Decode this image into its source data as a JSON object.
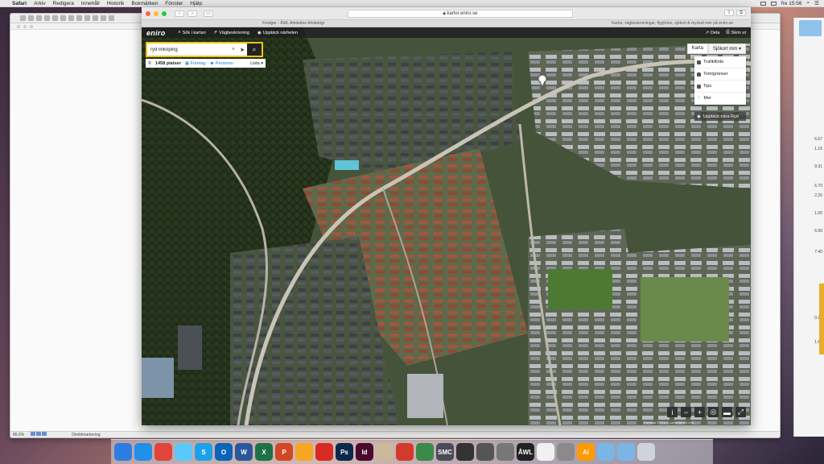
{
  "menubar": {
    "apple": "",
    "items": [
      "Safari",
      "Arkiv",
      "Redigera",
      "Innehåll",
      "Historik",
      "Bokmärken",
      "Fönster",
      "Hjälp"
    ],
    "clock": "fre 15:56"
  },
  "doc_window": {
    "status_zoom": "86.6%",
    "status_mode": "Direktmarkering"
  },
  "right_window": {
    "numbers": [
      "6.67",
      "1.16",
      "9.31",
      "6.70",
      "2.20",
      "1.00",
      "5.50",
      "7.40",
      "0.18",
      "1.60"
    ]
  },
  "safari": {
    "url": "kartor.eniro.se",
    "tab_left": "Kredger - ÅWL Arkitekter Arkitektgr",
    "tab_right": "Kartor, vägbeskrivningar, flygfoton, sjökort & mycket mer på eniro.se"
  },
  "eniro": {
    "logo": "eniro",
    "nav": [
      {
        "icon": "search-icon",
        "label": "Sök i kartan"
      },
      {
        "icon": "route-icon",
        "label": "Vägbeskrivning"
      },
      {
        "icon": "eye-icon",
        "label": "Upptäck närheten"
      }
    ],
    "nav_right": [
      {
        "icon": "share-icon",
        "label": "Dela"
      },
      {
        "icon": "print-icon",
        "label": "Skriv ut"
      }
    ],
    "search": {
      "value": "ryd linköping",
      "placeholder": ""
    },
    "results": {
      "count": "1458 platser",
      "companies": "Företag",
      "persons": "Personer",
      "list": "Lista"
    },
    "map_type": {
      "map": "Karta",
      "sea": "Sjökort mm"
    },
    "layers": [
      {
        "icon": "traffic-icon",
        "label": "Trafikflöde"
      },
      {
        "icon": "border-icon",
        "label": "Tomtgränser"
      },
      {
        "icon": "tips-icon",
        "label": "Tips"
      },
      {
        "icon": "more-icon",
        "label": "Mer"
      }
    ],
    "explore": "Upptäck nära Ryd",
    "controls": [
      "i",
      "−",
      "+",
      "◎",
      "▬",
      "⤢"
    ],
    "copyright": "Kartdata © Eniro, Lantmäteriet m.fl."
  },
  "dock": {
    "apps": [
      {
        "icon": "finder-icon",
        "label": "",
        "color": "#2d7de0"
      },
      {
        "icon": "safari-icon",
        "label": "",
        "color": "#1f8fe8"
      },
      {
        "icon": "chrome-icon",
        "label": "",
        "color": "#e0443a"
      },
      {
        "icon": "messages-icon",
        "label": "",
        "color": "#5ac8fa"
      },
      {
        "icon": "skype-icon",
        "label": "S",
        "color": "#1da1e6"
      },
      {
        "icon": "outlook-icon",
        "label": "O",
        "color": "#0a64b8"
      },
      {
        "icon": "word-icon",
        "label": "W",
        "color": "#2b579a"
      },
      {
        "icon": "excel-icon",
        "label": "X",
        "color": "#1e7145"
      },
      {
        "icon": "powerpoint-icon",
        "label": "P",
        "color": "#d24726"
      },
      {
        "icon": "photos-icon",
        "label": "",
        "color": "#f5a623"
      },
      {
        "icon": "acrobat-icon",
        "label": "",
        "color": "#d62b22"
      },
      {
        "icon": "photoshop-icon",
        "label": "Ps",
        "color": "#0b2a4a"
      },
      {
        "icon": "indesign-icon",
        "label": "Id",
        "color": "#4a0a2c"
      },
      {
        "icon": "textedit-icon",
        "label": "",
        "color": "#c9b89a"
      },
      {
        "icon": "sketchup-icon",
        "label": "",
        "color": "#d43a2c"
      },
      {
        "icon": "vectorworks-icon",
        "label": "",
        "color": "#3a8a4a"
      },
      {
        "icon": "smc-icon",
        "label": "SMC",
        "color": "#4a4a5a"
      },
      {
        "icon": "app-icon",
        "label": "",
        "color": "#333"
      },
      {
        "icon": "app-icon",
        "label": "",
        "color": "#555"
      },
      {
        "icon": "app-icon",
        "label": "",
        "color": "#777"
      },
      {
        "icon": "awl-icon",
        "label": "ÅWL",
        "color": "#222"
      },
      {
        "icon": "calendar-icon",
        "label": "",
        "color": "#f1f1f1"
      },
      {
        "icon": "settings-icon",
        "label": "",
        "color": "#8a8a8a"
      },
      {
        "icon": "illustrator-icon",
        "label": "Ai",
        "color": "#ff9a00"
      },
      {
        "icon": "folder-icon",
        "label": "",
        "color": "#7ab5e6"
      },
      {
        "icon": "folder-icon",
        "label": "",
        "color": "#7ab5e6"
      },
      {
        "icon": "trash-icon",
        "label": "",
        "color": "#cfd4da"
      }
    ]
  }
}
